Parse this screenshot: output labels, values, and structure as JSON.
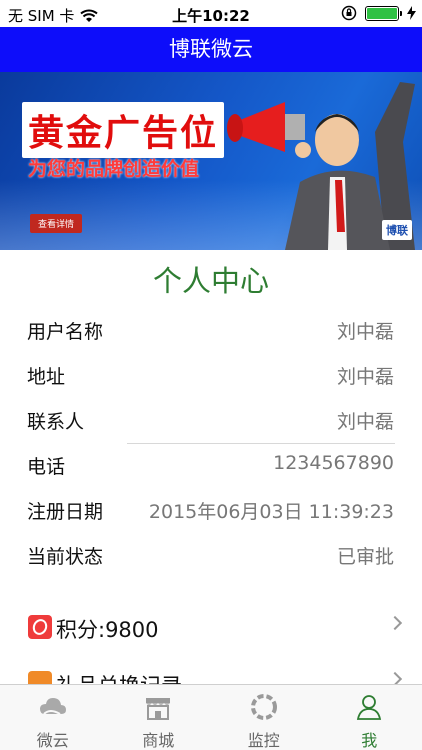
{
  "status_bar": {
    "carrier": "无 SIM 卡",
    "time": "上午10:22"
  },
  "nav": {
    "title": "博联微云"
  },
  "banner": {
    "headline": "黄金广告位",
    "subline": "为您的品牌创造价值",
    "button": "查看详情",
    "brand": "博联"
  },
  "profile": {
    "title": "个人中心",
    "rows": [
      {
        "label": "用户名称",
        "value": "刘中磊"
      },
      {
        "label": "地址",
        "value": "刘中磊"
      },
      {
        "label": "联系人",
        "value": "刘中磊"
      },
      {
        "label": "电话",
        "value": "1234567890"
      },
      {
        "label": "注册日期",
        "value": "2015年06月03日 11:39:23"
      },
      {
        "label": "当前状态",
        "value": "已审批"
      }
    ]
  },
  "menu": [
    {
      "label": "积分:9800",
      "icon": "points-icon"
    },
    {
      "label": "礼品兑换记录",
      "icon": "gift-icon"
    }
  ],
  "tabs": [
    {
      "label": "微云",
      "icon": "cloud-icon",
      "active": false
    },
    {
      "label": "商城",
      "icon": "store-icon",
      "active": false
    },
    {
      "label": "监控",
      "icon": "monitor-icon",
      "active": false
    },
    {
      "label": "我",
      "icon": "user-icon",
      "active": true
    }
  ],
  "colors": {
    "nav": "#0d0dfa",
    "accent_green": "#2e7d32",
    "icon_red": "#ef3b3b",
    "battery_green": "#2fc144"
  }
}
